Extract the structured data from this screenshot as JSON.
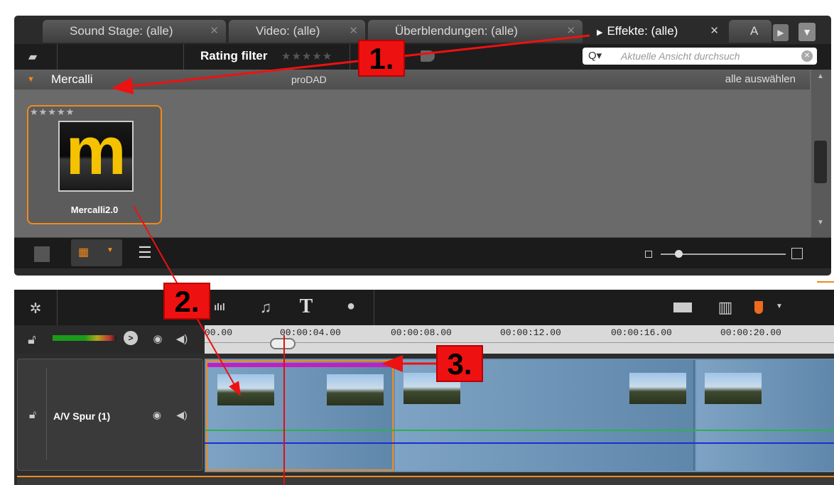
{
  "tabs": [
    {
      "label": "Sound Stage: (alle)"
    },
    {
      "label": "Video: (alle)"
    },
    {
      "label": "Überblendungen: (alle)"
    },
    {
      "label": "Effekte: (alle)"
    },
    {
      "label": "A"
    }
  ],
  "toolbar": {
    "rating_filter_label": "Rating filter",
    "search_placeholder": "Aktuelle Ansicht durchsuch"
  },
  "group": {
    "title": "Mercalli",
    "vendor": "proDAD",
    "select_all": "alle auswählen"
  },
  "effect": {
    "name": "Mercalli2.0",
    "logo_letter": "m"
  },
  "timeline": {
    "ruler_ticks": [
      "00.00",
      "00:00:04.00",
      "00:00:08.00",
      "00:00:12.00",
      "00:00:16.00",
      "00:00:20.00"
    ],
    "track_name": "A/V Spur (1)"
  },
  "callouts": [
    "1.",
    "2.",
    "3."
  ],
  "colors": {
    "accent": "#f08a1c",
    "callout": "#ee1111",
    "effect_marker": "#c020c0"
  }
}
